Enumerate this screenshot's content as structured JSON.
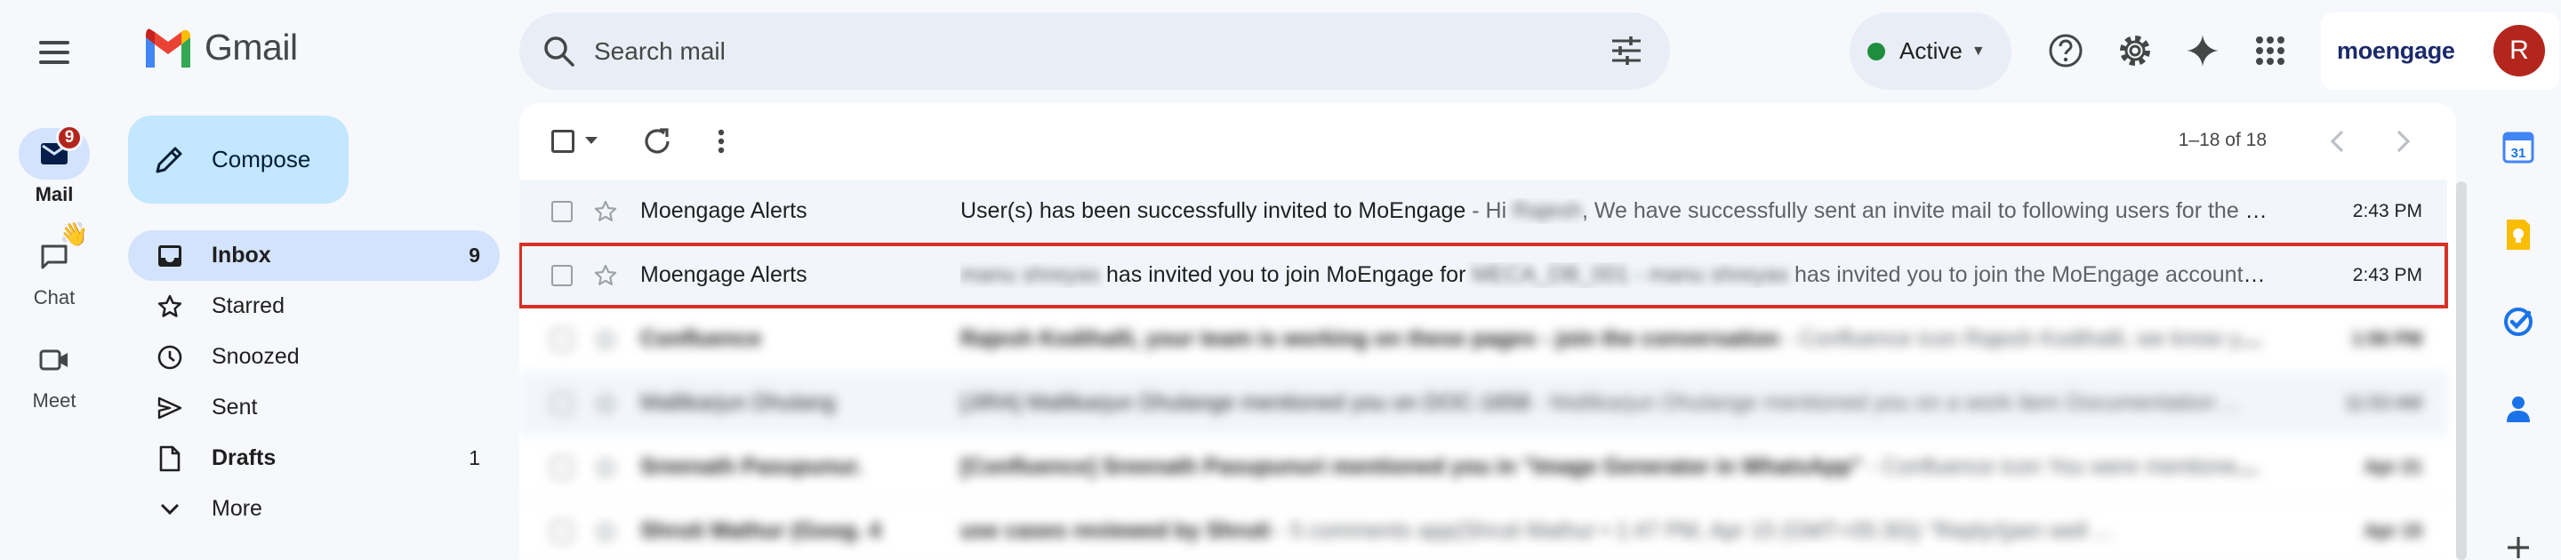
{
  "app": {
    "name": "Gmail"
  },
  "rail": {
    "items": [
      {
        "label": "Mail",
        "badge": "9",
        "icon": "mail-icon"
      },
      {
        "label": "Chat",
        "icon": "chat-icon",
        "emoji": "👋"
      },
      {
        "label": "Meet",
        "icon": "video-icon"
      }
    ]
  },
  "compose": {
    "label": "Compose"
  },
  "nav": {
    "items": [
      {
        "label": "Inbox",
        "count": "9",
        "icon": "inbox-icon"
      },
      {
        "label": "Starred",
        "count": "",
        "icon": "star-icon"
      },
      {
        "label": "Snoozed",
        "count": "",
        "icon": "clock-icon"
      },
      {
        "label": "Sent",
        "count": "",
        "icon": "send-icon"
      },
      {
        "label": "Drafts",
        "count": "1",
        "icon": "draft-icon"
      },
      {
        "label": "More",
        "count": "",
        "icon": "chevron-down-icon"
      }
    ]
  },
  "search": {
    "placeholder": "Search mail"
  },
  "status": {
    "label": "Active"
  },
  "account": {
    "brand": "moengage",
    "avatar_initial": "R"
  },
  "toolbar": {
    "count_label": "1–18 of 18"
  },
  "emails": [
    {
      "sender": "Moengage Alerts",
      "subject": "User(s) has been successfully invited to MoEngage",
      "snippet_prefix": " - Hi ",
      "redacted_1": "Rajesh",
      "snippet_suffix": ", We have successfully sent an invite mail to following users for the MoEngage account ...",
      "time": "2:43 PM"
    },
    {
      "sender": "Moengage Alerts",
      "redacted_1": "manu shreyas",
      "subject": " has invited you to join MoEngage for ",
      "redacted_2": "MECA_DB_001 - manu shreyas",
      "snippet_suffix": " has invited you to join the MoEngage account for the workspace ...",
      "time": "2:43 PM"
    },
    {
      "sender": "Confluence",
      "subject": "Rajesh Kodihalli, your team is working on these pages - join the conversation",
      "snippet_suffix": " - Confluence icon Rajesh Kodihalli, we know you're busy, so we've gathered ...",
      "time": "1:56 PM"
    },
    {
      "sender": "Mallikarjun Dhulang",
      "subject": "[JIRA] Mallikarjun Dhulange mentioned you on DOC-1658",
      "snippet_suffix": " - Mallikarjun Dhulange mentioned you on a work item Documentation ...",
      "time": "11:53 AM"
    },
    {
      "sender": "Sreenath Pasupunur.",
      "subject": "[Confluence] Sreenath Pasupunuri mentioned you in \"Image Generator in WhatsApp\"",
      "snippet_suffix": " - Confluence icon You were mentioned ...",
      "time": "Apr 21"
    },
    {
      "sender": "Shruti Mathur (Goog. 4",
      "subject": "use cases reviewed by Shruti",
      "snippet_suffix": " - 5 comments app(Shruti Mathur • 1:47 PM, Apr 15 (GMT+05:30)) \"Reply/(pen well ...",
      "time": "Apr 15"
    }
  ],
  "colors": {
    "background": "#f6f8fc",
    "compose": "#c2e7ff",
    "active_nav": "#d3e3fd",
    "badge": "#b3261e",
    "highlight_outline": "#d93025",
    "status_dot": "#1e8e3e"
  }
}
